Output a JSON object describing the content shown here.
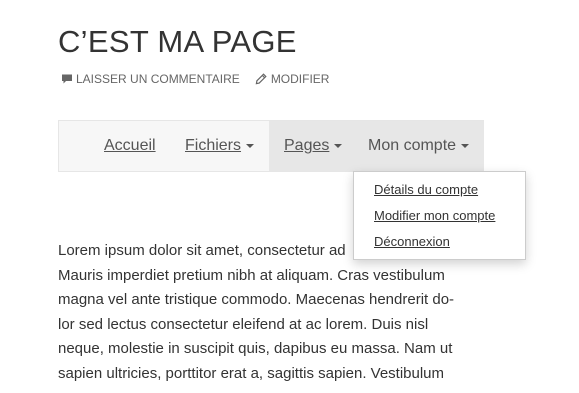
{
  "page": {
    "title": "C’EST MA PAGE",
    "meta": {
      "comment_label": "LAISSER UN COMMENTAIRE",
      "comment_icon": "comment-icon",
      "edit_label": "MODIFIER",
      "edit_icon": "pencil-icon"
    }
  },
  "nav": {
    "items": [
      {
        "label": "Accueil",
        "has_dropdown": false
      },
      {
        "label": "Fichiers",
        "has_dropdown": true
      },
      {
        "label": "Pages",
        "has_dropdown": true
      },
      {
        "label": "Mon compte",
        "has_dropdown": true,
        "open": true
      }
    ],
    "dropdown": {
      "items": [
        {
          "label": "Détails du compte"
        },
        {
          "label": "Modifier mon compte"
        },
        {
          "label": "Déconnexion"
        }
      ]
    }
  },
  "content": {
    "lines": [
      "Lorem ipsum dolor sit amet, consectetur ad",
      "Mauris imperdiet pretium nibh at aliquam. Cras vestibulum",
      "magna vel ante tristique commodo. Maecenas hendrerit do-",
      "lor sed lectus consectetur eleifend at ac lorem. Duis nisl",
      "neque, molestie in suscipit quis, dapibus eu massa. Nam ut",
      "sapien ultricies, porttitor erat a, sagittis sapien. Vestibulum"
    ]
  },
  "colors": {
    "text": "#333333",
    "meta": "#666666",
    "nav_bg": "#f7f7f7",
    "nav_active_bg": "#e7e7e7"
  }
}
